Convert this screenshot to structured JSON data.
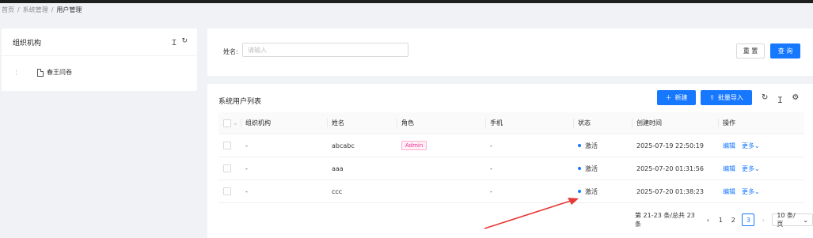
{
  "breadcrumb": {
    "home": "首页",
    "sep": "/",
    "system": "系统管理",
    "current": "用户管理"
  },
  "left": {
    "title": "组织机构",
    "tool1": "Ｉ",
    "tool2": "↻",
    "tree_node": "春王问卷"
  },
  "search": {
    "label": "姓名:",
    "placeholder": "请输入",
    "reset": "重 置",
    "query": "查 询"
  },
  "table_panel": {
    "title": "系统用户列表",
    "new_label": "新建",
    "import_label": "批量导入",
    "columns": [
      "组织机构",
      "姓名",
      "角色",
      "手机",
      "状态",
      "创建时间",
      "操作"
    ],
    "rows": [
      {
        "org": "-",
        "name": "abcabc",
        "role": "Admin",
        "phone": "-",
        "status": "激活",
        "created": "2025-07-19 22:50:19",
        "edit": "编辑",
        "more": "更多"
      },
      {
        "org": "-",
        "name": "aaa",
        "role": "",
        "phone": "-",
        "status": "激活",
        "created": "2025-07-20 01:31:56",
        "edit": "编辑",
        "more": "更多"
      },
      {
        "org": "-",
        "name": "ccc",
        "role": "",
        "phone": "-",
        "status": "激活",
        "created": "2025-07-20 01:38:23",
        "edit": "编辑",
        "more": "更多"
      }
    ]
  },
  "pager": {
    "summary": "第 21-23 条/总共 23 条",
    "prev": "‹",
    "p1": "1",
    "p2": "2",
    "p3": "3",
    "next": "›",
    "size": "10 条/页"
  },
  "colors": {
    "primary": "#1677ff",
    "tag": "#eb2f96",
    "arrow": "#e53935"
  }
}
